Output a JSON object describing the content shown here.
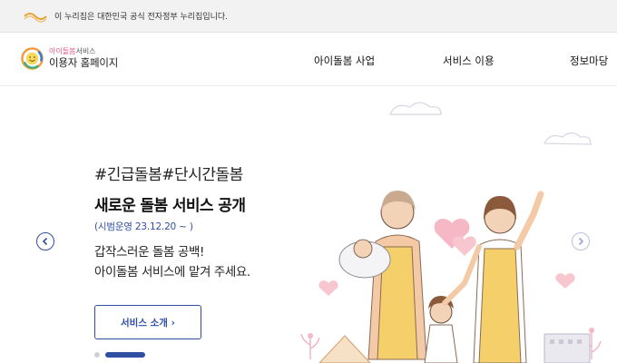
{
  "gov_banner": {
    "text": "이 누리집은 대한민국 공식 전자정부 누리집입니다."
  },
  "brand": {
    "sub_highlight": "아이돌봄",
    "sub_rest": "서비스",
    "title": "이용자 홈페이지"
  },
  "nav": {
    "items": [
      {
        "label": "아이돌봄 사업"
      },
      {
        "label": "서비스 이용"
      },
      {
        "label": "정보마당"
      }
    ]
  },
  "hero": {
    "tag": "#긴급돌봄#단시간돌봄",
    "headline": "새로운 돌봄 서비스 공개",
    "pilot": "(시범운영 23.12.20 ~ )",
    "desc_line1": "갑작스러운 돌봄 공백!",
    "desc_line2": "아이돌봄 서비스에 맡겨 주세요.",
    "cta_label": "서비스 소개 ›"
  },
  "slider": {
    "total": 2,
    "active": 2
  },
  "colors": {
    "accent": "#2f4fa3",
    "pink": "#e8598a",
    "gov_bar": "#f2f2f2"
  },
  "icons": {
    "prev": "chevron-left-icon",
    "next": "chevron-right-icon",
    "gov": "eg-logo",
    "brand": "smile-logo"
  }
}
